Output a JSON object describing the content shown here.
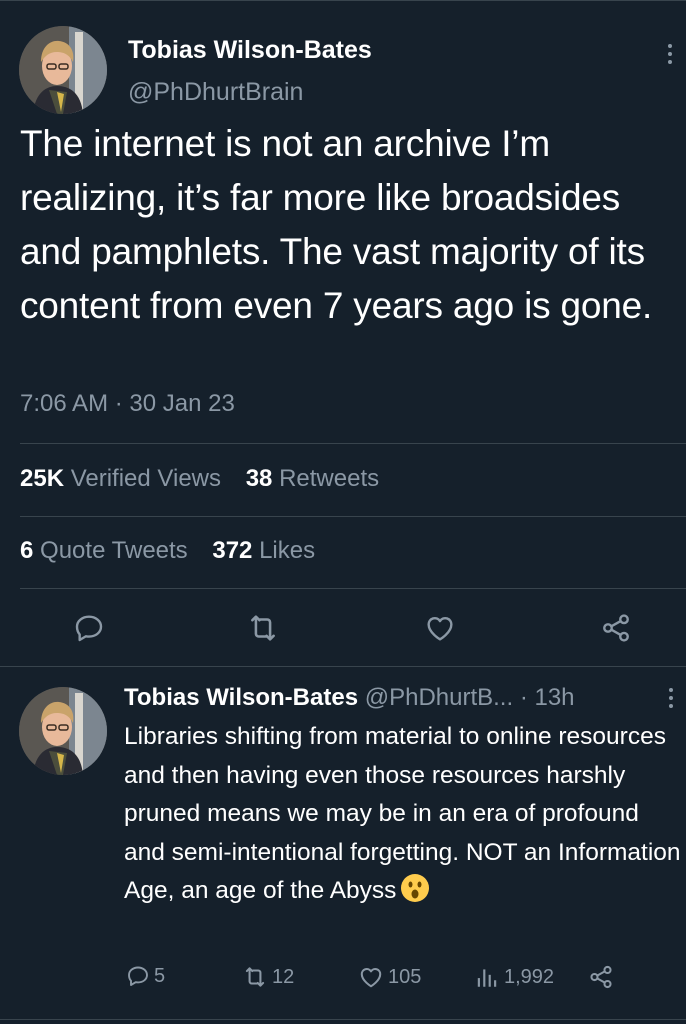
{
  "main_tweet": {
    "author_name": "Tobias Wilson-Bates",
    "author_handle": "@PhDhurtBrain",
    "text": "The internet is not an archive I’m realizing, it’s far more like broadsides and pamphlets. The vast majority of its content from even 7 years ago is gone.",
    "timestamp": "7:06 AM · 30 Jan 23",
    "stats": {
      "views_count": "25K",
      "views_label": "Verified Views",
      "retweets_count": "38",
      "retweets_label": "Retweets",
      "quotes_count": "6",
      "quotes_label": "Quote Tweets",
      "likes_count": "372",
      "likes_label": "Likes"
    },
    "actions": [
      "reply-icon",
      "retweet-icon",
      "like-icon",
      "share-icon"
    ]
  },
  "reply_tweet": {
    "author_name": "Tobias Wilson-Bates",
    "author_handle": "@PhDhurtB...",
    "time_ago": "· 13h",
    "text": "Libraries shifting from material to online resources and then having even those resources harshly pruned means we may be in an era of profound and semi-intentional forgetting. NOT an Information Age, an age of the Abyss",
    "emoji": "astonished-face-emoji",
    "actions": {
      "replies": "5",
      "retweets": "12",
      "likes": "105",
      "views": "1,992"
    }
  },
  "colors": {
    "background": "#15202b",
    "text_primary": "#ffffff",
    "text_secondary": "#8b98a5",
    "divider": "#38444d"
  }
}
